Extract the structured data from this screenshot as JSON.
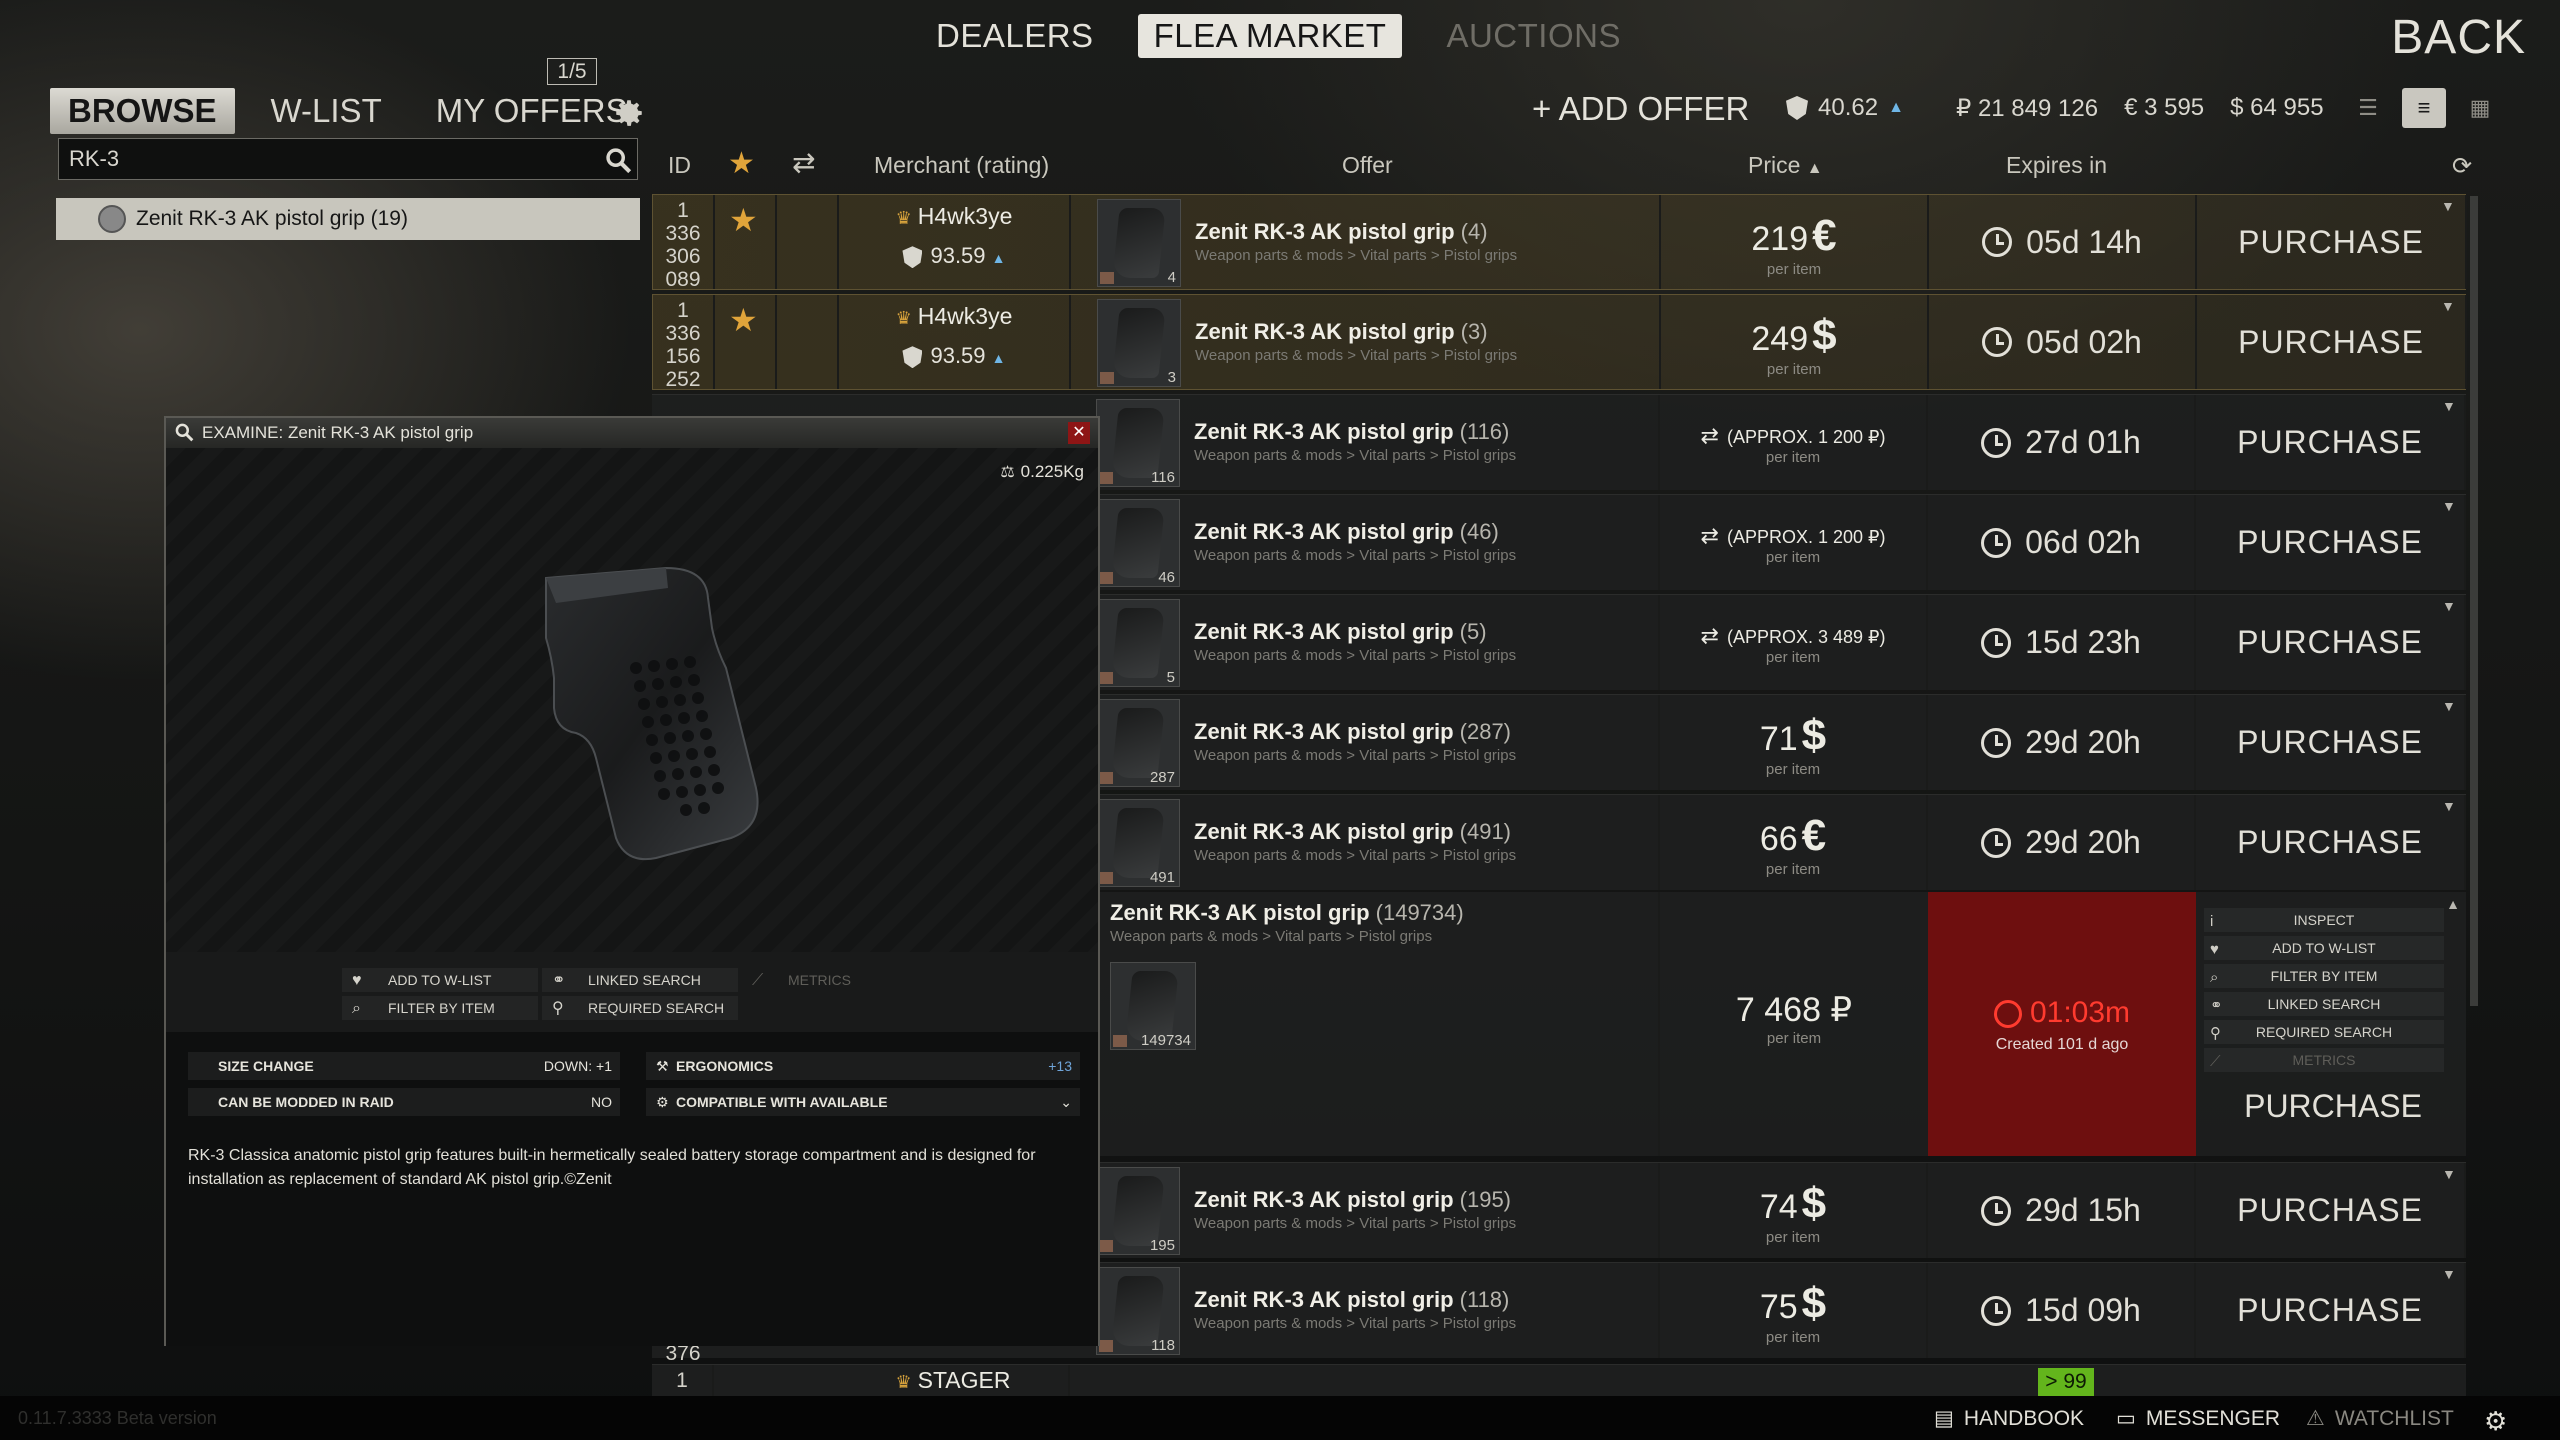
{
  "nav": {
    "tabs": [
      "DEALERS",
      "FLEA MARKET",
      "AUCTIONS"
    ],
    "back": "BACK"
  },
  "subtabs": {
    "browse": "BROWSE",
    "wlist": "W-LIST",
    "my_offers": "MY OFFERS",
    "offer_count": "1/5"
  },
  "header": {
    "add_offer": "+ ADD OFFER",
    "rating": "40.62",
    "rubles": "₽ 21 849 126",
    "euros": "€ 3 595",
    "dollars": "$ 64 955"
  },
  "search": {
    "value": "RK-3",
    "result": "Zenit RK-3 AK pistol grip (19)"
  },
  "columns": {
    "id": "ID",
    "merchant": "Merchant (rating)",
    "offer": "Offer",
    "price": "Price",
    "expires": "Expires in"
  },
  "item_category": "Weapon parts & mods > Vital parts > Pistol grips",
  "per_item": "per item",
  "purchase": "PURCHASE",
  "rows": [
    {
      "id": [
        "1",
        "336",
        "306",
        "089"
      ],
      "merchant": "H4wk3ye",
      "rating": "93.59",
      "name": "Zenit RK-3 AK pistol grip",
      "count": "(4)",
      "qty": "4",
      "price": "219",
      "cur": "€",
      "expires": "05d 14h"
    },
    {
      "id": [
        "1",
        "336",
        "156",
        "252"
      ],
      "merchant": "H4wk3ye",
      "rating": "93.59",
      "name": "Zenit RK-3 AK pistol grip",
      "count": "(3)",
      "qty": "3",
      "price": "249",
      "cur": "$",
      "expires": "05d 02h"
    },
    {
      "name": "Zenit RK-3 AK pistol grip",
      "count": "(116)",
      "qty": "116",
      "barter": "(APPROX. 1 200 ₽)",
      "expires": "27d 01h"
    },
    {
      "name": "Zenit RK-3 AK pistol grip",
      "count": "(46)",
      "qty": "46",
      "barter": "(APPROX. 1 200 ₽)",
      "expires": "06d 02h"
    },
    {
      "name": "Zenit RK-3 AK pistol grip",
      "count": "(5)",
      "qty": "5",
      "barter": "(APPROX. 3 489 ₽)",
      "expires": "15d 23h"
    },
    {
      "name": "Zenit RK-3 AK pistol grip",
      "count": "(287)",
      "qty": "287",
      "price": "71",
      "cur": "$",
      "expires": "29d 20h"
    },
    {
      "name": "Zenit RK-3 AK pistol grip",
      "count": "(491)",
      "qty": "491",
      "price": "66",
      "cur": "€",
      "expires": "29d 20h"
    }
  ],
  "expanded": {
    "name": "Zenit RK-3 AK pistol grip",
    "count": "(149734)",
    "qty": "149734",
    "price": "7 468 ₽",
    "expires": "01:03m",
    "created": "Created 101 d ago",
    "menu": [
      "INSPECT",
      "ADD TO W-LIST",
      "FILTER BY ITEM",
      "LINKED SEARCH",
      "REQUIRED SEARCH",
      "METRICS"
    ]
  },
  "rows_after": [
    {
      "name": "Zenit RK-3 AK pistol grip",
      "count": "(195)",
      "qty": "195",
      "price": "74",
      "cur": "$",
      "expires": "29d 15h"
    },
    {
      "name": "Zenit RK-3 AK pistol grip",
      "count": "(118)",
      "qty": "118",
      "price": "75",
      "cur": "$",
      "expires": "15d 09h"
    }
  ],
  "partial_row": {
    "id_top": "376",
    "id": "1",
    "merchant": "STAGER",
    "badge": "> 99"
  },
  "examine": {
    "title": "EXAMINE: Zenit RK-3 AK pistol grip",
    "weight": "0.225Kg",
    "actions": {
      "add_wlist": "ADD TO W-LIST",
      "linked": "LINKED SEARCH",
      "metrics": "METRICS",
      "filter": "FILTER BY ITEM",
      "required": "REQUIRED SEARCH"
    },
    "stats": {
      "size_change": "SIZE CHANGE",
      "size_change_val": "DOWN: +1",
      "ergonomics": "ERGONOMICS",
      "ergonomics_val": "+13",
      "modded": "CAN BE MODDED IN RAID",
      "modded_val": "NO",
      "compatible": "COMPATIBLE WITH AVAILABLE"
    },
    "description": "RK-3 Classica anatomic pistol grip features built-in hermetically sealed battery storage compartment and is designed for installation as replacement of standard AK pistol grip.©Zenit"
  },
  "bottom": {
    "version": "0.11.7.3333 Beta version",
    "handbook": "HANDBOOK",
    "messenger": "MESSENGER",
    "watchlist": "WATCHLIST"
  },
  "colors": {
    "accent_gold": "#e0a43a",
    "expired_red": "#6e0f0f",
    "positive_green": "#63b51c"
  }
}
